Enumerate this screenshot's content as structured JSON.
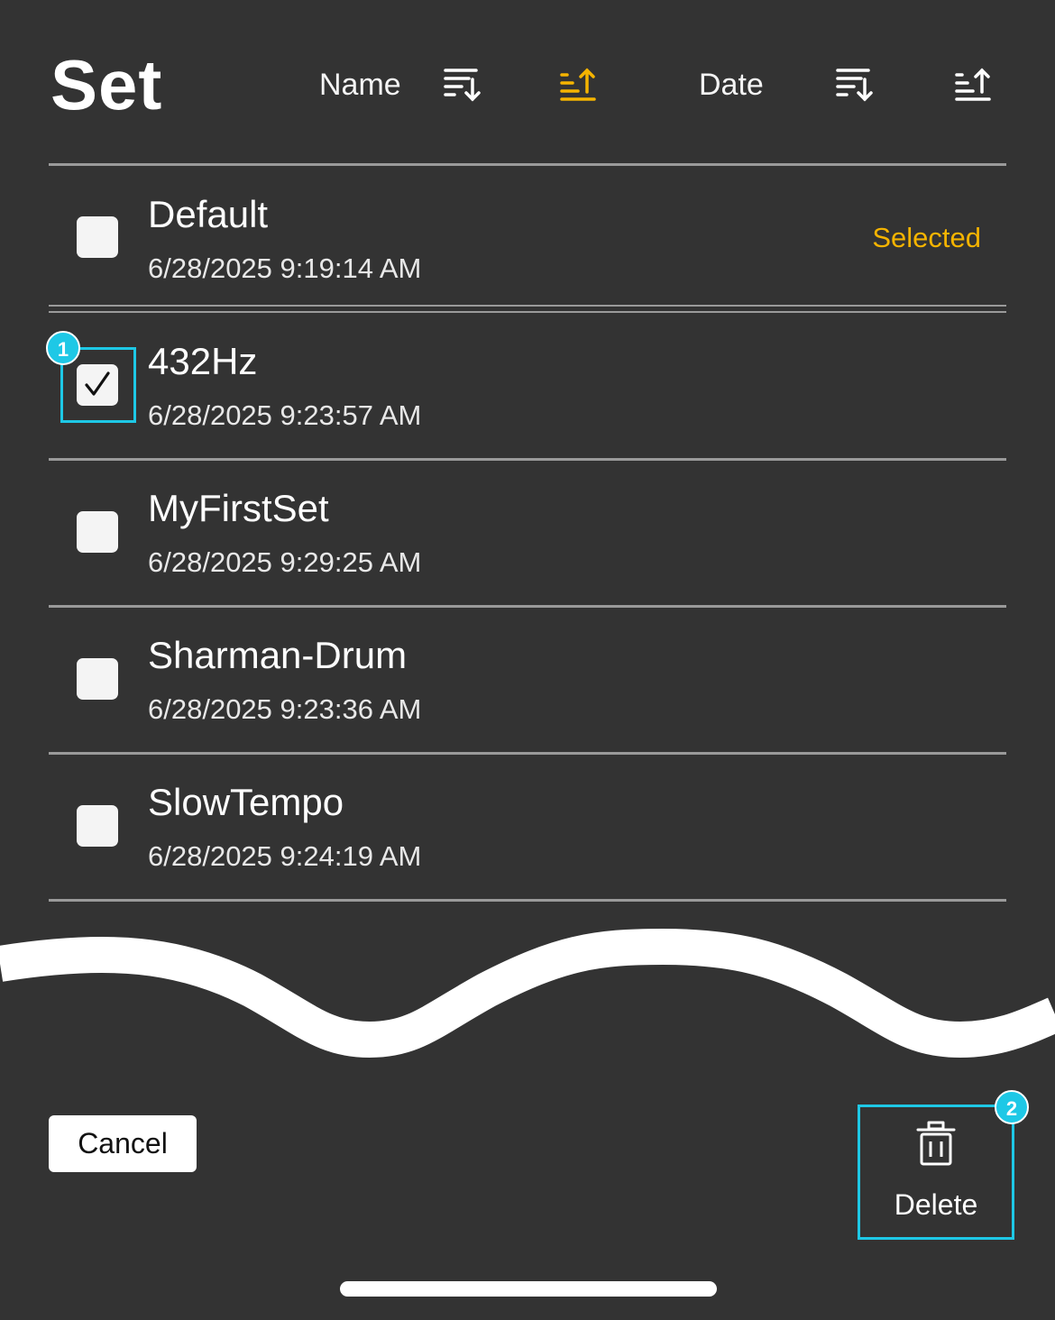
{
  "header": {
    "title": "Set",
    "sort_name_label": "Name",
    "sort_date_label": "Date",
    "icons": {
      "name_desc": "sort-descending-icon",
      "name_asc": "sort-ascending-icon",
      "date_desc": "sort-descending-icon",
      "date_asc": "sort-ascending-icon"
    },
    "active_sort": "name-ascending"
  },
  "colors": {
    "background": "#333333",
    "accent": "#f5b400",
    "annotation": "#1ec8e6",
    "divider": "#9a9a9a"
  },
  "items": [
    {
      "name": "Default",
      "date": "6/28/2025 9:19:14 AM",
      "checked": false,
      "status": "Selected"
    },
    {
      "name": "432Hz",
      "date": "6/28/2025 9:23:57 AM",
      "checked": true,
      "status": ""
    },
    {
      "name": "MyFirstSet",
      "date": "6/28/2025 9:29:25 AM",
      "checked": false,
      "status": ""
    },
    {
      "name": "Sharman-Drum",
      "date": "6/28/2025 9:23:36 AM",
      "checked": false,
      "status": ""
    },
    {
      "name": "SlowTempo",
      "date": "6/28/2025 9:24:19 AM",
      "checked": false,
      "status": ""
    }
  ],
  "annotations": [
    {
      "number": "1",
      "target": "432Hz checkbox"
    },
    {
      "number": "2",
      "target": "Delete button"
    }
  ],
  "footer": {
    "cancel_label": "Cancel",
    "delete_label": "Delete",
    "delete_icon": "trash-icon"
  }
}
